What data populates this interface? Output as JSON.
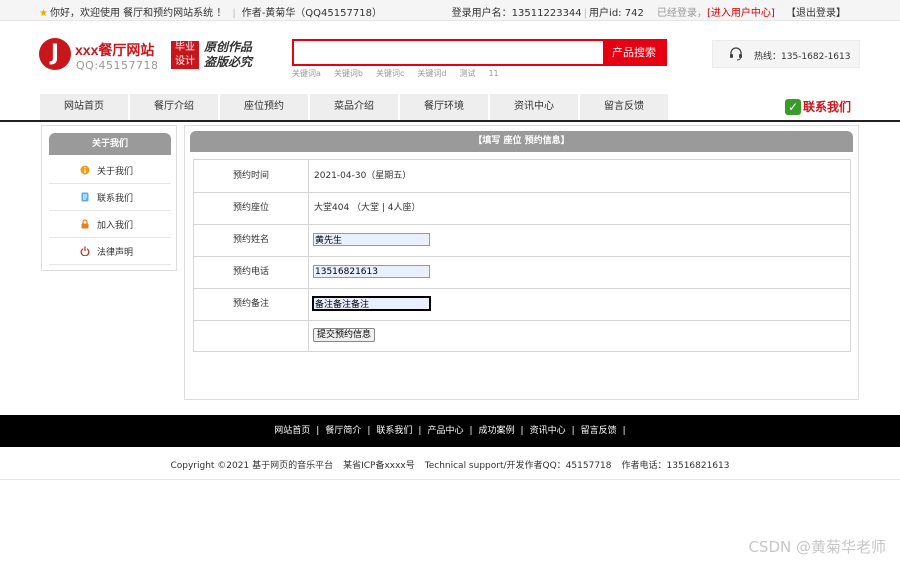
{
  "topbar": {
    "welcome": "你好，欢迎使用 餐厅和预约网站系统 ！",
    "author": "作者-黄菊华（QQ45157718）",
    "login_user_label": "登录用户名：13511223344",
    "user_id_label": "用户id: 742",
    "login_status": "已经登录，",
    "user_center": "[进入用户中心]",
    "logout": "【退出登录】"
  },
  "header": {
    "logo_letter": "J",
    "logo_title": "xxx餐厅网站",
    "logo_qq": "QQ:45157718",
    "badge_line1": "毕业",
    "badge_line2": "设计",
    "slogan_line1": "原创作品",
    "slogan_line2": "盗版必究",
    "search_placeholder": "",
    "search_button": "产品搜索",
    "keywords": [
      "关键词a",
      "关键词b",
      "关键词c",
      "关键词d",
      "测试",
      "11"
    ],
    "hotline": "热线：135-1682-1613"
  },
  "nav": {
    "items": [
      "网站首页",
      "餐厅介绍",
      "座位预约",
      "菜品介绍",
      "餐厅环境",
      "资讯中心",
      "留言反馈"
    ],
    "contact_us": "联系我们"
  },
  "sidebar": {
    "title": "关于我们",
    "items": [
      {
        "label": "关于我们",
        "icon": "info-icon"
      },
      {
        "label": "联系我们",
        "icon": "contact-icon"
      },
      {
        "label": "加入我们",
        "icon": "lock-icon"
      },
      {
        "label": "法律声明",
        "icon": "power-icon"
      }
    ]
  },
  "reservation": {
    "title": "【填写 座位 预约信息】",
    "time_label": "预约时间",
    "time_value": "2021-04-30（星期五）",
    "seat_label": "预约座位",
    "seat_value": "大堂404 （大堂 | 4人座）",
    "name_label": "预约姓名",
    "name_value": "黄先生",
    "phone_label": "预约电话",
    "phone_value": "13516821613",
    "note_label": "预约备注",
    "note_value": "备注备注备注",
    "submit_label": "提交预约信息"
  },
  "footer": {
    "links": [
      "网站首页",
      "餐厅简介",
      "联系我们",
      "产品中心",
      "成功案例",
      "资讯中心",
      "留言反馈"
    ],
    "copyright": "Copyright ©2021 基于网页的音乐平台",
    "icp": "某省ICP备xxxx号",
    "support": "Technical support/开发作者QQ：45157718",
    "phone": "作者电话：13516821613"
  },
  "watermark": "CSDN @黄菊华老师",
  "colors": {
    "brand_red": "#c8161d",
    "search_red": "#e60012",
    "header_gray": "#9a9a9a",
    "footer_black": "#000000"
  }
}
